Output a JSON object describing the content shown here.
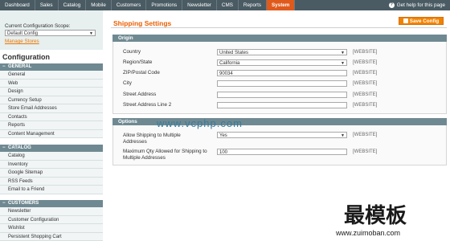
{
  "nav": {
    "tabs": [
      "Dashboard",
      "Sales",
      "Catalog",
      "Mobile",
      "Customers",
      "Promotions",
      "Newsletter",
      "CMS",
      "Reports",
      "System"
    ],
    "active": "System",
    "help": "Get help for this page"
  },
  "sidebar": {
    "scope_label": "Current Configuration Scope:",
    "scope_value": "Default Config",
    "manage_stores": "Manage Stores",
    "config_title": "Configuration",
    "groups": [
      {
        "title": "GENERAL",
        "items": [
          "General",
          "Web",
          "Design",
          "Currency Setup",
          "Store Email Addresses",
          "Contacts",
          "Reports",
          "Content Management"
        ]
      },
      {
        "title": "CATALOG",
        "items": [
          "Catalog",
          "Inventory",
          "Google Sitemap",
          "RSS Feeds",
          "Email to a Friend"
        ]
      },
      {
        "title": "CUSTOMERS",
        "items": [
          "Newsletter",
          "Customer Configuration",
          "Wishlist",
          "Persistent Shopping Cart"
        ]
      }
    ]
  },
  "main": {
    "title": "Shipping Settings",
    "save_label": "Save Config",
    "origin": {
      "title": "Origin",
      "fields": [
        {
          "label": "Country",
          "value": "United States",
          "scope": "[WEBSITE]"
        },
        {
          "label": "Region/State",
          "value": "California",
          "scope": "[WEBSITE]"
        },
        {
          "label": "ZIP/Postal Code",
          "value": "90034",
          "scope": "[WEBSITE]"
        },
        {
          "label": "City",
          "value": "",
          "scope": "[WEBSITE]"
        },
        {
          "label": "Street Address",
          "value": "",
          "scope": "[WEBSITE]"
        },
        {
          "label": "Street Address Line 2",
          "value": "",
          "scope": "[WEBSITE]"
        }
      ]
    },
    "options": {
      "title": "Options",
      "fields": [
        {
          "label": "Allow Shipping to Multiple Addresses",
          "value": "Yes",
          "scope": "[WEBSITE]"
        },
        {
          "label": "Maximum Qty Allowed for Shipping to Multiple Addresses",
          "value": "100",
          "scope": "[WEBSITE]"
        }
      ]
    }
  },
  "watermarks": {
    "center": "www.vcphp.com",
    "brand": "最模板",
    "url": "www.zuimoban.com"
  }
}
